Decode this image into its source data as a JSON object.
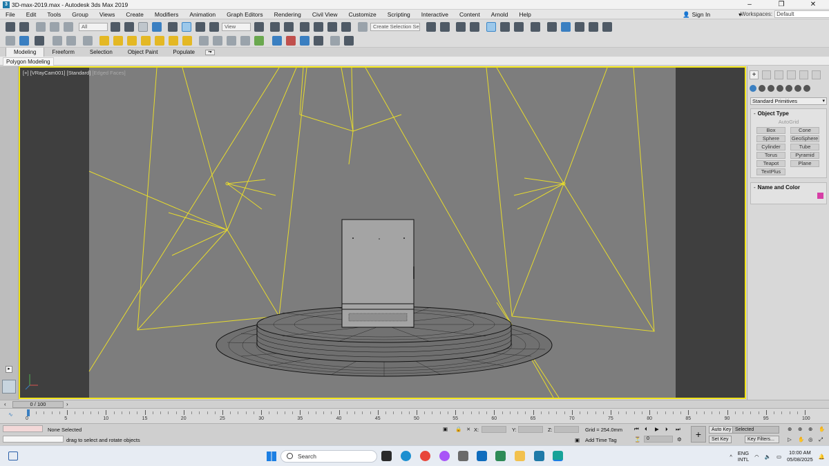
{
  "window": {
    "title": "3D-max-2019.max - Autodesk 3ds Max 2019",
    "controls": [
      "–",
      "❐",
      "✕"
    ]
  },
  "menu": [
    "File",
    "Edit",
    "Tools",
    "Group",
    "Views",
    "Create",
    "Modifiers",
    "Animation",
    "Graph Editors",
    "Rendering",
    "Civil View",
    "Customize",
    "Scripting",
    "Interactive",
    "Content",
    "Arnold",
    "Help"
  ],
  "account": {
    "sign_in": "Sign In",
    "workspaces_label": "Workspaces:",
    "workspace": "Default"
  },
  "toolbar": {
    "filter": "All",
    "ref_coord": "View",
    "selection_set": "Create Selection Se"
  },
  "ribbon": {
    "tabs": [
      "Modeling",
      "Freeform",
      "Selection",
      "Object Paint",
      "Populate"
    ],
    "active": "Modeling",
    "subpanel": "Polygon Modeling"
  },
  "viewport": {
    "label_view": "[+]",
    "label_camera": "[VRayCam001]",
    "label_shading": "[Standard]",
    "label_mode": "[Edged Faces]"
  },
  "command_panel": {
    "category": "Standard Primitives",
    "object_type_title": "Object Type",
    "autogrid": "AutoGrid",
    "primitives": [
      "Box",
      "Cone",
      "Sphere",
      "GeoSphere",
      "Cylinder",
      "Tube",
      "Torus",
      "Pyramid",
      "Teapot",
      "Plane",
      "TextPlus"
    ],
    "name_color_title": "Name and Color",
    "object_color": "#d63fa6"
  },
  "timeline": {
    "frame_display": "0 / 100",
    "ticks": [
      "0",
      "5",
      "10",
      "15",
      "20",
      "25",
      "30",
      "35",
      "40",
      "45",
      "50",
      "55",
      "60",
      "65",
      "70",
      "75",
      "80",
      "85",
      "90",
      "95",
      "100"
    ]
  },
  "status": {
    "selection": "None Selected",
    "prompt": "drag to select and rotate objects",
    "x_label": "X:",
    "y_label": "Y:",
    "z_label": "Z:",
    "grid": "Grid = 254.0mm",
    "add_time_tag": "Add Time Tag",
    "auto_key": "Auto Key",
    "set_key": "Set Key",
    "key_mode": "Selected",
    "key_filters": "Key Filters...",
    "frame": "0"
  },
  "taskbar": {
    "search_placeholder": "Search",
    "lang_top": "ENG",
    "lang_bottom": "INTL",
    "time": "10:00 AM",
    "date": "05/08/2025"
  }
}
